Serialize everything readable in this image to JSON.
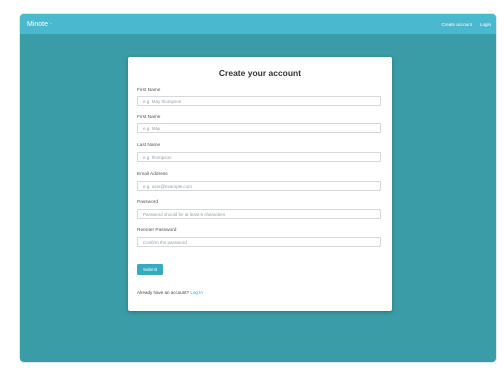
{
  "navbar": {
    "brand": "Minote",
    "brand_mark": "◦",
    "create_account": "Create account",
    "login": "Login"
  },
  "form": {
    "title": "Create your account",
    "fields": [
      {
        "label": "First Name",
        "placeholder": "e.g. May thompson"
      },
      {
        "label": "First Name",
        "placeholder": "e.g. May"
      },
      {
        "label": "Last Name",
        "placeholder": "e.g. thompson"
      },
      {
        "label": "Email Address",
        "placeholder": "e.g. user@example.com"
      },
      {
        "label": "Password",
        "placeholder": "Password should be at least 6 characters"
      },
      {
        "label": "Reenter Password",
        "placeholder": "Confirm the password"
      }
    ],
    "submit_label": "Submit",
    "footer_text": "Already have an account?",
    "footer_link": "Log In"
  },
  "colors": {
    "navbar": "#4ab9cf",
    "background": "#3a9ca6",
    "button": "#3aa9bf"
  }
}
